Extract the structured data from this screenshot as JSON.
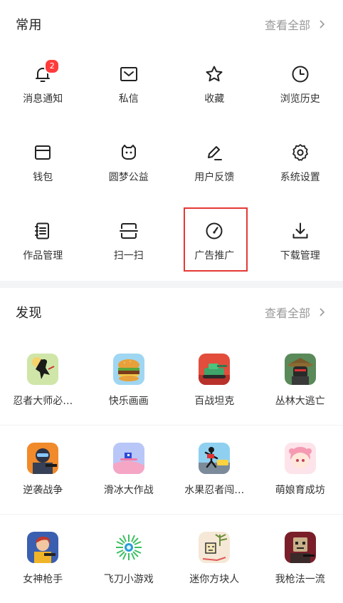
{
  "common": {
    "title": "常用",
    "view_all": "查看全部",
    "items": [
      {
        "label": "消息通知",
        "icon": "bell-icon",
        "badge": "2"
      },
      {
        "label": "私信",
        "icon": "mail-icon"
      },
      {
        "label": "收藏",
        "icon": "star-icon"
      },
      {
        "label": "浏览历史",
        "icon": "clock-icon"
      },
      {
        "label": "钱包",
        "icon": "wallet-icon"
      },
      {
        "label": "圆梦公益",
        "icon": "cat-face-icon"
      },
      {
        "label": "用户反馈",
        "icon": "pen-icon"
      },
      {
        "label": "系统设置",
        "icon": "gear-icon"
      },
      {
        "label": "作品管理",
        "icon": "notebook-icon"
      },
      {
        "label": "扫一扫",
        "icon": "scan-icon"
      },
      {
        "label": "广告推广",
        "icon": "gauge-icon"
      },
      {
        "label": "下载管理",
        "icon": "download-icon"
      }
    ],
    "highlight_color": "#e53935"
  },
  "discover": {
    "title": "发现",
    "view_all": "查看全部",
    "games": [
      {
        "label": "忍者大师必…",
        "icon": "ninja-game-icon"
      },
      {
        "label": "快乐画画",
        "icon": "burger-game-icon"
      },
      {
        "label": "百战坦克",
        "icon": "tank-game-icon"
      },
      {
        "label": "丛林大逃亡",
        "icon": "jungle-game-icon"
      },
      {
        "label": "逆袭战争",
        "icon": "soldier-game-icon"
      },
      {
        "label": "滑冰大作战",
        "icon": "skate-game-icon"
      },
      {
        "label": "水果忍者闯…",
        "icon": "stickman-game-icon"
      },
      {
        "label": "萌娘育成坊",
        "icon": "anime-girl-game-icon"
      },
      {
        "label": "女神枪手",
        "icon": "gunner-game-icon"
      },
      {
        "label": "飞刀小游戏",
        "icon": "knife-game-icon"
      },
      {
        "label": "迷你方块人",
        "icon": "block-man-game-icon"
      },
      {
        "label": "我枪法一流",
        "icon": "shooter-game-icon"
      }
    ]
  }
}
